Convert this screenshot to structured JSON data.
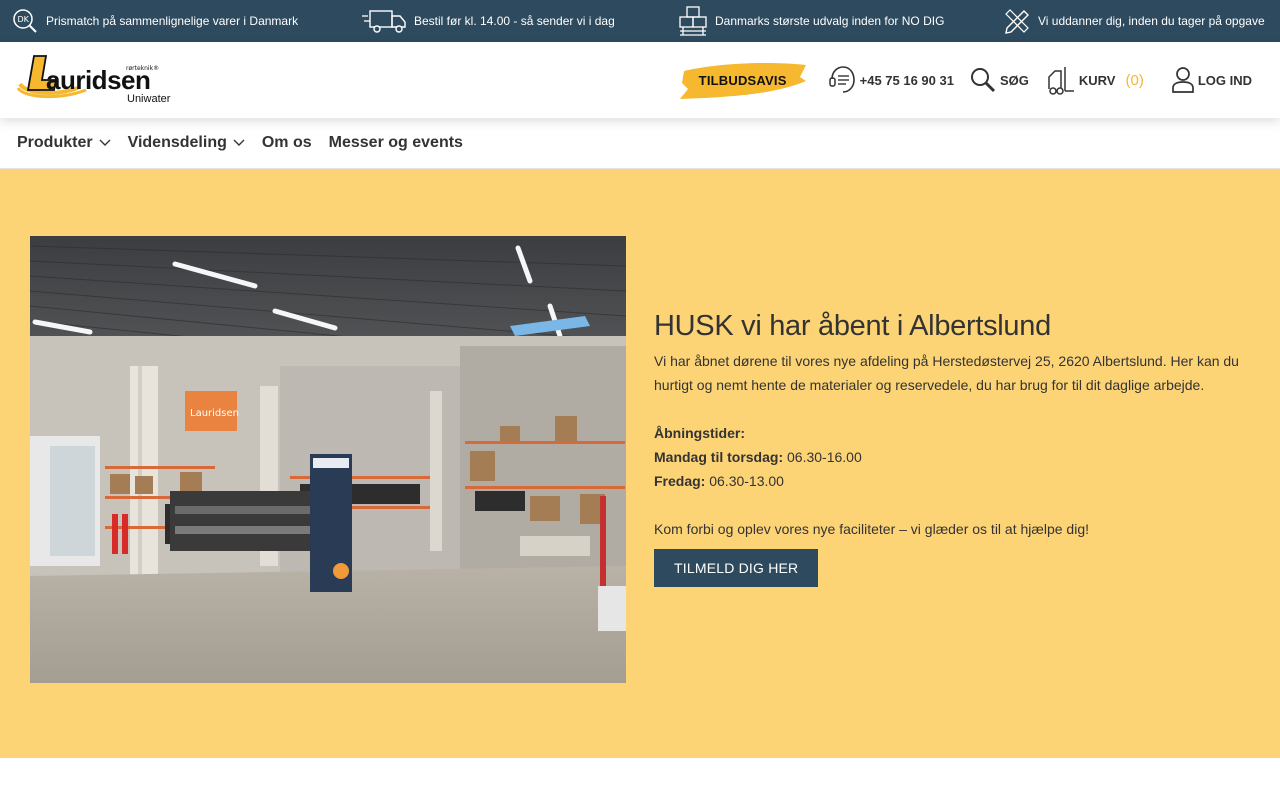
{
  "topbar": {
    "usps": [
      {
        "icon": "dk-search-icon",
        "text": "Prismatch på sammenlignelige varer i Danmark"
      },
      {
        "icon": "truck-icon",
        "text": "Bestil før kl. 14.00 - så sender vi i dag"
      },
      {
        "icon": "boxes-icon",
        "text": "Danmarks største udvalg inden for NO DIG"
      },
      {
        "icon": "pencil-ruler-icon",
        "text": "Vi uddanner dig, inden du tager på opgave"
      }
    ]
  },
  "header": {
    "logo": {
      "name": "Lauridsen",
      "tagline": "rørteknik",
      "sub": "Uniwater"
    },
    "offer_label": "TILBUDSAVIS",
    "phone": "+45 75 16 90 31",
    "search_label": "SØG",
    "cart_label": "KURV",
    "cart_count": "(0)",
    "login_label": "LOG IND"
  },
  "nav": {
    "items": [
      {
        "label": "Produkter"
      },
      {
        "label": "Vidensdeling"
      },
      {
        "label": "Om os"
      },
      {
        "label": "Messer og events"
      }
    ]
  },
  "hero": {
    "title": "HUSK vi har åbent i Albertslund",
    "intro": "Vi har åbnet dørene til vores nye afdeling på Herstedøstervej 25, 2620 Albertslund. Her kan du hurtigt og nemt hente de materialer og reservedele, du har brug for til dit daglige arbejde.",
    "hours_heading": "Åbningstider:",
    "weekday_label": "Mandag til torsdag:",
    "weekday_hours": "06.30-16.00",
    "friday_label": "Fredag:",
    "friday_hours": "06.30-13.00",
    "outro": "Kom forbi og oplev vores nye faciliteter – vi glæder os til at hjælpe dig!",
    "cta_label": "TILMELD DIG HER"
  },
  "colors": {
    "topbar_bg": "#2e4a5e",
    "hero_bg": "#fdd475",
    "accent": "#f5b82e",
    "cta_bg": "#2e4a5e"
  }
}
